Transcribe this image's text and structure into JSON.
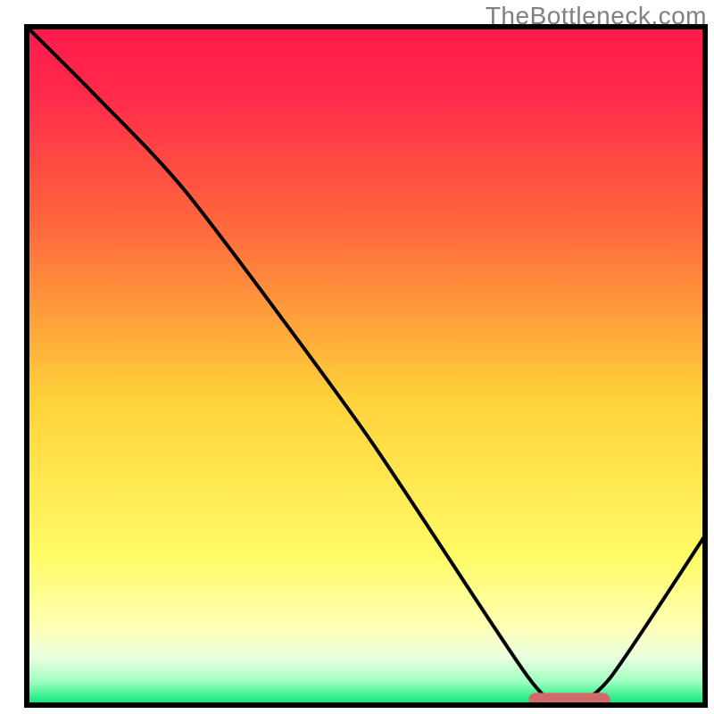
{
  "watermark": "TheBottleneck.com",
  "chart_data": {
    "type": "line",
    "title": "",
    "xlabel": "",
    "ylabel": "",
    "xlim": [
      0,
      100
    ],
    "ylim": [
      0,
      100
    ],
    "grid": false,
    "legend": false,
    "gradient_colors": {
      "top": "#ff1744",
      "upper_mid": "#ff7043",
      "mid": "#ffeb3b",
      "lower_mid": "#fff59d",
      "band_pale": "#e8f5e9",
      "bottom": "#00e676"
    },
    "series": [
      {
        "name": "curve",
        "stroke": "#000000",
        "stroke_width": 3,
        "x": [
          0,
          10,
          24,
          50,
          74,
          80,
          86,
          100
        ],
        "y": [
          100,
          90,
          75,
          40,
          4,
          0,
          4,
          25
        ]
      }
    ],
    "marker": {
      "name": "min-band",
      "color": "#d36a6a",
      "x_start": 74,
      "x_end": 86,
      "y": 0.8,
      "height": 2.0,
      "corner_radius": 1.0
    },
    "frame": {
      "stroke": "#000000",
      "stroke_width": 6
    }
  }
}
